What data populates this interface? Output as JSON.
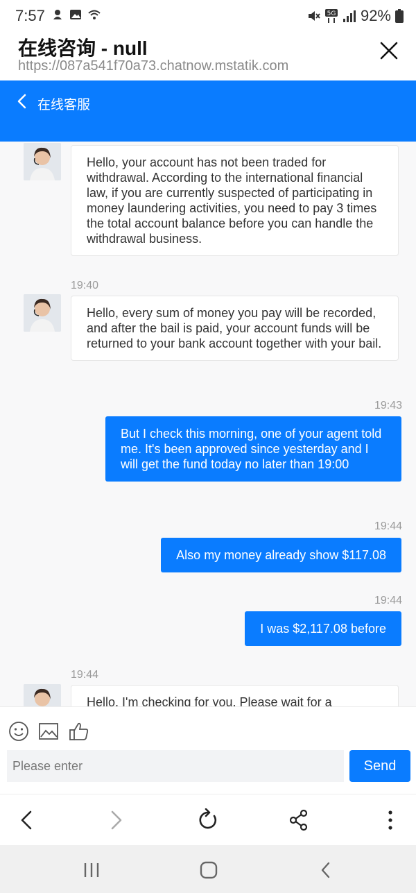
{
  "status_bar": {
    "time": "7:57",
    "battery": "92%"
  },
  "browser": {
    "title": "在线咨询 - null",
    "url": "https://087a541f70a73.chatnow.mstatik.com"
  },
  "app_bar": {
    "title": "在线客服"
  },
  "messages": [
    {
      "from": "agent",
      "time": "",
      "text": "Hello, your account has not been traded for withdrawal. According to the international financial law, if you are currently suspected of participating in money laundering activities, you need to pay 3 times the total account balance before you can handle the withdrawal business."
    },
    {
      "from": "agent",
      "time": "19:40",
      "text": "Hello, every sum of money you pay will be recorded, and after the bail is paid, your account funds will be returned to your bank account together with your bail."
    },
    {
      "from": "user",
      "time": "19:43",
      "text": "But I check this morning, one of your agent told me. It's been approved since yesterday and I will get the fund today no later than 19:00"
    },
    {
      "from": "user",
      "time": "19:44",
      "text": "Also my money already show $117.08"
    },
    {
      "from": "user",
      "time": "19:44",
      "text": "I was $2,117.08 before"
    },
    {
      "from": "agent",
      "time": "19:44",
      "text": "Hello, I'm checking for you. Please wait for a"
    }
  ],
  "composer": {
    "placeholder": "Please enter",
    "send_label": "Send"
  },
  "icons": {
    "toolbar": [
      "emoji-icon",
      "image-icon",
      "thumbs-up-icon"
    ],
    "browser_nav": [
      "back-icon",
      "forward-icon",
      "reload-icon",
      "share-icon",
      "more-icon"
    ],
    "system_nav": [
      "recents-icon",
      "home-icon",
      "system-back-icon"
    ]
  },
  "colors": {
    "accent": "#0a7cff",
    "chat_bg": "#f8f8f9"
  }
}
